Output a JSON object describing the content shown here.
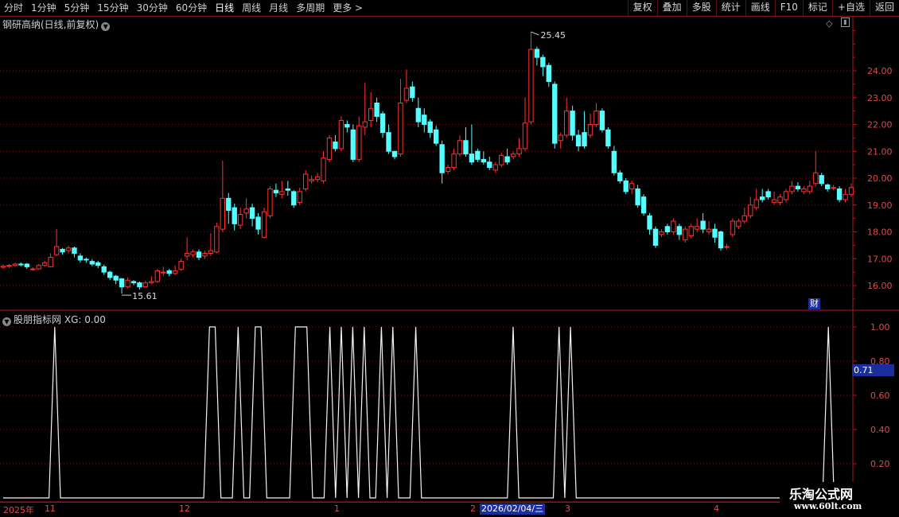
{
  "toolbar": {
    "periods": [
      "分时",
      "1分钟",
      "5分钟",
      "15分钟",
      "30分钟",
      "60分钟",
      "日线",
      "周线",
      "月线",
      "多周期",
      "更多 >"
    ],
    "active_period": "日线",
    "buttons": [
      "复权",
      "叠加",
      "多股",
      "统计",
      "画线",
      "F10",
      "标记",
      "+自选",
      "返回"
    ]
  },
  "main_panel": {
    "title": "钢研高纳(日线,前复权)",
    "max_label": "25.45",
    "min_label": "15.61",
    "y_axis_ticks": [
      "24.00",
      "23.00",
      "22.00",
      "21.00",
      "20.00",
      "19.00",
      "18.00",
      "17.00",
      "16.00"
    ],
    "finance_badge": "财"
  },
  "indicator_panel": {
    "title": "股朋指标网",
    "value_label": "XG: 0.00",
    "y_axis_ticks": [
      "1.00",
      "0.80",
      "0.60",
      "0.40",
      "0.20"
    ],
    "cursor_value": "0.71"
  },
  "date_axis": {
    "labels": [
      "2025年",
      "11",
      "12",
      "1",
      "2",
      "3",
      "4"
    ],
    "cursor_date": "2026/02/04/三"
  },
  "watermark": {
    "line1": "乐淘公式网",
    "line2": "www.60lt.com"
  },
  "colors": {
    "up": "#ff3232",
    "down": "#54ffff",
    "grid": "#7a1010",
    "axis": "#b01818"
  },
  "chart_data": {
    "type": "candlestick",
    "ylim": [
      15.2,
      25.7
    ],
    "candles": [
      [
        16.68,
        16.72,
        16.62,
        16.78
      ],
      [
        16.72,
        16.75,
        16.65,
        16.8
      ],
      [
        16.75,
        16.8,
        16.7,
        16.85
      ],
      [
        16.8,
        16.78,
        16.72,
        16.86
      ],
      [
        16.8,
        16.7,
        16.62,
        16.84
      ],
      [
        16.6,
        16.62,
        16.55,
        16.68
      ],
      [
        16.62,
        16.75,
        16.58,
        16.8
      ],
      [
        16.75,
        16.85,
        16.7,
        16.92
      ],
      [
        16.7,
        17.05,
        16.68,
        17.2
      ],
      [
        17.15,
        17.45,
        17.1,
        18.1
      ],
      [
        17.35,
        17.25,
        17.15,
        17.4
      ],
      [
        17.3,
        17.4,
        17.2,
        17.48
      ],
      [
        17.4,
        17.2,
        17.05,
        17.45
      ],
      [
        17.1,
        16.95,
        16.85,
        17.2
      ],
      [
        16.98,
        16.95,
        16.85,
        17.05
      ],
      [
        16.9,
        16.8,
        16.72,
        16.98
      ],
      [
        16.85,
        16.75,
        16.65,
        16.92
      ],
      [
        16.7,
        16.5,
        16.4,
        16.78
      ],
      [
        16.5,
        16.3,
        16.2,
        16.55
      ],
      [
        16.35,
        16.2,
        16.05,
        16.4
      ],
      [
        16.25,
        15.95,
        15.7,
        16.28
      ],
      [
        15.95,
        16.2,
        15.9,
        16.3
      ],
      [
        16.15,
        16.1,
        16.02,
        16.2
      ],
      [
        16.1,
        15.95,
        15.85,
        16.15
      ],
      [
        15.95,
        16.1,
        15.92,
        16.18
      ],
      [
        16.1,
        16.15,
        16.05,
        16.35
      ],
      [
        16.15,
        16.55,
        16.1,
        16.62
      ],
      [
        16.5,
        16.5,
        16.35,
        16.7
      ],
      [
        16.55,
        16.45,
        16.35,
        16.62
      ],
      [
        16.45,
        16.55,
        16.38,
        16.75
      ],
      [
        16.6,
        16.9,
        16.55,
        17.0
      ],
      [
        17.1,
        17.2,
        16.95,
        17.8
      ],
      [
        17.15,
        17.25,
        17.05,
        17.35
      ],
      [
        17.25,
        17.05,
        16.95,
        17.35
      ],
      [
        17.1,
        17.2,
        17.0,
        17.3
      ],
      [
        17.2,
        17.3,
        17.1,
        17.95
      ],
      [
        17.25,
        18.2,
        17.2,
        18.35
      ],
      [
        18.1,
        19.25,
        18.0,
        20.65
      ],
      [
        19.25,
        18.8,
        18.3,
        19.45
      ],
      [
        18.9,
        18.3,
        18.05,
        19.05
      ],
      [
        18.25,
        18.65,
        18.1,
        18.9
      ],
      [
        18.7,
        18.85,
        18.5,
        19.25
      ],
      [
        18.9,
        18.5,
        18.2,
        19.05
      ],
      [
        18.55,
        18.1,
        17.9,
        18.7
      ],
      [
        17.8,
        18.75,
        17.75,
        18.9
      ],
      [
        18.6,
        19.6,
        18.5,
        19.7
      ],
      [
        19.55,
        19.45,
        19.3,
        19.8
      ],
      [
        19.4,
        19.5,
        19.25,
        19.9
      ],
      [
        19.6,
        19.55,
        19.35,
        19.9
      ],
      [
        19.5,
        19.0,
        18.9,
        19.55
      ],
      [
        19.1,
        19.5,
        19.0,
        19.65
      ],
      [
        19.6,
        20.15,
        19.5,
        20.3
      ],
      [
        19.9,
        19.95,
        19.8,
        20.1
      ],
      [
        19.95,
        20.05,
        19.85,
        20.2
      ],
      [
        19.9,
        20.75,
        19.8,
        21.0
      ],
      [
        20.7,
        21.5,
        20.6,
        21.6
      ],
      [
        21.35,
        21.1,
        21.0,
        21.6
      ],
      [
        21.1,
        22.15,
        21.0,
        22.3
      ],
      [
        22.0,
        21.9,
        21.7,
        22.15
      ],
      [
        21.8,
        20.7,
        20.6,
        22.0
      ],
      [
        20.7,
        21.95,
        20.6,
        22.3
      ],
      [
        21.9,
        22.1,
        21.6,
        23.55
      ],
      [
        22.15,
        22.6,
        21.9,
        23.2
      ],
      [
        22.8,
        22.3,
        22.1,
        23.0
      ],
      [
        22.4,
        21.7,
        21.5,
        22.5
      ],
      [
        21.7,
        21.0,
        20.9,
        22.0
      ],
      [
        21.0,
        20.8,
        20.7,
        21.0
      ],
      [
        20.9,
        22.8,
        20.8,
        23.7
      ],
      [
        22.9,
        23.35,
        22.8,
        24.05
      ],
      [
        23.4,
        23.0,
        22.85,
        23.6
      ],
      [
        22.6,
        22.1,
        21.9,
        23.0
      ],
      [
        22.35,
        22.0,
        21.7,
        22.6
      ],
      [
        22.1,
        21.7,
        21.5,
        22.2
      ],
      [
        21.8,
        21.3,
        21.2,
        21.95
      ],
      [
        21.25,
        20.2,
        19.8,
        21.4
      ],
      [
        20.25,
        20.4,
        20.15,
        20.5
      ],
      [
        20.4,
        20.9,
        20.3,
        21.1
      ],
      [
        20.9,
        21.4,
        20.8,
        21.6
      ],
      [
        21.4,
        20.9,
        20.8,
        21.9
      ],
      [
        20.9,
        20.6,
        20.5,
        22.0
      ],
      [
        21.0,
        20.7,
        20.6,
        21.1
      ],
      [
        20.7,
        20.6,
        20.5,
        21.0
      ],
      [
        20.6,
        20.4,
        20.3,
        20.8
      ],
      [
        20.3,
        20.5,
        20.2,
        20.6
      ],
      [
        20.5,
        20.85,
        20.4,
        20.95
      ],
      [
        20.8,
        20.6,
        20.5,
        21.1
      ],
      [
        20.8,
        20.9,
        20.7,
        21.0
      ],
      [
        20.9,
        21.1,
        20.8,
        21.5
      ],
      [
        21.1,
        22.05,
        21.0,
        23.0
      ],
      [
        22.1,
        24.8,
        22.0,
        25.45
      ],
      [
        24.8,
        24.5,
        24.2,
        24.9
      ],
      [
        24.5,
        24.15,
        23.8,
        24.6
      ],
      [
        24.2,
        23.6,
        23.4,
        24.3
      ],
      [
        23.5,
        21.3,
        21.1,
        23.6
      ],
      [
        21.4,
        21.6,
        21.1,
        21.7
      ],
      [
        21.6,
        22.5,
        21.5,
        23.0
      ],
      [
        22.5,
        21.6,
        21.4,
        22.7
      ],
      [
        21.6,
        21.2,
        21.0,
        21.8
      ],
      [
        21.7,
        21.2,
        21.1,
        22.5
      ],
      [
        21.6,
        22.0,
        21.5,
        22.4
      ],
      [
        22.0,
        22.5,
        21.9,
        22.8
      ],
      [
        22.5,
        21.8,
        21.7,
        22.6
      ],
      [
        21.8,
        21.2,
        21.1,
        21.9
      ],
      [
        21.0,
        20.2,
        20.1,
        21.2
      ],
      [
        20.2,
        19.9,
        19.8,
        20.3
      ],
      [
        19.9,
        19.5,
        19.4,
        20.0
      ],
      [
        19.6,
        19.8,
        19.4,
        19.9
      ],
      [
        19.6,
        19.0,
        18.9,
        19.75
      ],
      [
        19.3,
        18.7,
        18.6,
        19.4
      ],
      [
        18.6,
        18.1,
        17.9,
        18.7
      ],
      [
        18.1,
        17.5,
        17.4,
        18.2
      ],
      [
        17.9,
        18.0,
        17.8,
        18.1
      ],
      [
        18.2,
        18.0,
        17.9,
        18.3
      ],
      [
        18.0,
        18.4,
        17.9,
        18.5
      ],
      [
        18.2,
        17.9,
        17.7,
        18.3
      ],
      [
        17.7,
        18.1,
        17.6,
        18.2
      ],
      [
        17.85,
        18.2,
        17.75,
        18.3
      ],
      [
        18.1,
        18.2,
        18.0,
        18.5
      ],
      [
        18.4,
        18.1,
        17.95,
        18.7
      ],
      [
        18.0,
        18.1,
        17.9,
        18.4
      ],
      [
        18.1,
        17.8,
        17.6,
        18.3
      ],
      [
        18.0,
        17.4,
        17.3,
        18.05
      ],
      [
        17.45,
        17.45,
        17.35,
        17.55
      ],
      [
        17.9,
        18.4,
        17.8,
        18.5
      ],
      [
        18.2,
        18.4,
        18.1,
        18.5
      ],
      [
        18.4,
        18.6,
        18.3,
        18.9
      ],
      [
        18.6,
        19.0,
        18.5,
        19.3
      ],
      [
        18.9,
        19.2,
        18.8,
        19.6
      ],
      [
        19.3,
        19.2,
        19.1,
        19.6
      ],
      [
        19.5,
        19.3,
        19.2,
        19.6
      ],
      [
        19.1,
        19.2,
        19.0,
        19.5
      ],
      [
        19.1,
        19.3,
        19.0,
        19.4
      ],
      [
        19.2,
        19.5,
        19.1,
        19.6
      ],
      [
        19.5,
        19.7,
        19.4,
        19.9
      ],
      [
        19.7,
        19.6,
        19.5,
        19.85
      ],
      [
        19.5,
        19.6,
        19.4,
        19.7
      ],
      [
        19.5,
        19.7,
        19.4,
        19.9
      ],
      [
        19.8,
        20.2,
        19.7,
        21.0
      ],
      [
        20.1,
        19.8,
        19.7,
        20.2
      ],
      [
        19.75,
        19.6,
        19.5,
        19.8
      ],
      [
        19.65,
        19.65,
        19.55,
        19.75
      ],
      [
        19.6,
        19.2,
        19.1,
        19.7
      ],
      [
        19.2,
        19.4,
        19.1,
        19.6
      ],
      [
        19.4,
        19.65,
        19.3,
        19.8
      ]
    ],
    "xg_signal": [
      0,
      0,
      0,
      0,
      0,
      0,
      0,
      0,
      0,
      1,
      0,
      0,
      0,
      0,
      0,
      0,
      0,
      0,
      0,
      0,
      0,
      0,
      0,
      0,
      0,
      0,
      0,
      0,
      0,
      0,
      0,
      0,
      0,
      0,
      0,
      0,
      1,
      1,
      0,
      0,
      0,
      1,
      0,
      0,
      1,
      1,
      0,
      0,
      0,
      0,
      0,
      1,
      1,
      1,
      0,
      0,
      0,
      1,
      0,
      1,
      0,
      1,
      0,
      1,
      0,
      0,
      1,
      0,
      1,
      0,
      0,
      0,
      1,
      0,
      0,
      0,
      0,
      0,
      0,
      0,
      0,
      0,
      0,
      0,
      0,
      0,
      0,
      0,
      0,
      1,
      0,
      0,
      0,
      0,
      0,
      0,
      0,
      1,
      0,
      1,
      0,
      0,
      0,
      0,
      0,
      0,
      0,
      0,
      0,
      0,
      0,
      0,
      0,
      0,
      0,
      0,
      0,
      0,
      0,
      0,
      0,
      0,
      0,
      0,
      0,
      0,
      0,
      0,
      0,
      0,
      0,
      0,
      0,
      0,
      0,
      0,
      0,
      0,
      0,
      0,
      0,
      0,
      0,
      0,
      1,
      0,
      0,
      0,
      0
    ]
  }
}
